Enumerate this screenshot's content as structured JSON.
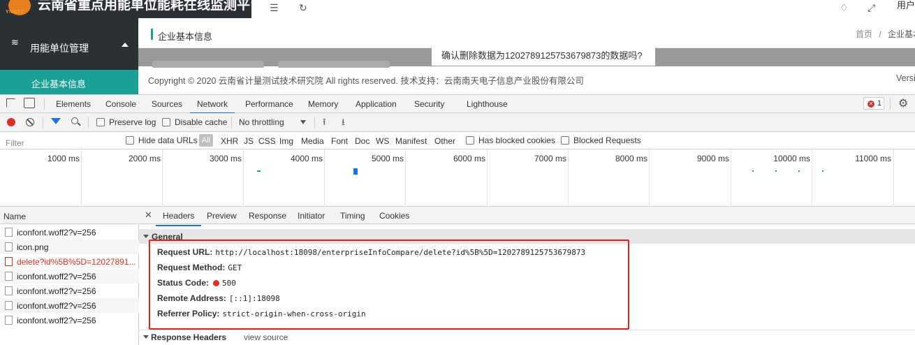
{
  "app": {
    "logo_text": "YNMTT",
    "title": "云南省重点用能单位能耗在线监测平台",
    "user_label": "用户",
    "sidebar": {
      "group_label": "用能单位管理",
      "active_item": "企业基本信息"
    },
    "page_title": "企业基本信息",
    "breadcrumb": [
      "首页",
      "/",
      "企业基本信"
    ],
    "confirm_text": "确认删除数据为1202789125753679873的数据吗?",
    "copyright": "Copyright © 2020 云南省计量测试技术研究院 All rights reserved. 技术支持：云南南天电子信息产业股份有限公司",
    "version": "Versi"
  },
  "devtools": {
    "tabs": [
      "Elements",
      "Console",
      "Sources",
      "Network",
      "Performance",
      "Memory",
      "Application",
      "Security",
      "Lighthouse"
    ],
    "active_tab": "Network",
    "error_count": "1",
    "toolbar": {
      "preserve_log": "Preserve log",
      "disable_cache": "Disable cache",
      "throttling": "No throttling"
    },
    "filter": {
      "placeholder": "Filter",
      "hide_data_urls": "Hide data URLs",
      "all": "All",
      "types": [
        "XHR",
        "JS",
        "CSS",
        "Img",
        "Media",
        "Font",
        "Doc",
        "WS",
        "Manifest",
        "Other"
      ],
      "has_blocked_cookies": "Has blocked cookies",
      "blocked_requests": "Blocked Requests"
    },
    "timeline_labels": [
      "1000 ms",
      "2000 ms",
      "3000 ms",
      "4000 ms",
      "5000 ms",
      "6000 ms",
      "7000 ms",
      "8000 ms",
      "9000 ms",
      "10000 ms",
      "11000 ms"
    ],
    "names_header": "Name",
    "requests": [
      {
        "name": "iconfont.woff2?v=256",
        "error": false
      },
      {
        "name": "icon.png",
        "error": false
      },
      {
        "name": "delete?id%5B%5D=12027891...",
        "error": true
      },
      {
        "name": "iconfont.woff2?v=256",
        "error": false
      },
      {
        "name": "iconfont.woff2?v=256",
        "error": false
      },
      {
        "name": "iconfont.woff2?v=256",
        "error": false
      },
      {
        "name": "iconfont.woff2?v=256",
        "error": false
      }
    ],
    "detail_tabs": [
      "Headers",
      "Preview",
      "Response",
      "Initiator",
      "Timing",
      "Cookies"
    ],
    "active_detail_tab": "Headers",
    "general": {
      "section_label": "General",
      "request_url_key": "Request URL:",
      "request_url": "http://localhost:18098/enterpriseInfoCompare/delete?id%5B%5D=1202789125753679873",
      "request_method_key": "Request Method:",
      "request_method": "GET",
      "status_code_key": "Status Code:",
      "status_code": "500",
      "remote_address_key": "Remote Address:",
      "remote_address": "[::1]:18098",
      "referrer_policy_key": "Referrer Policy:",
      "referrer_policy": "strict-origin-when-cross-origin"
    },
    "response_headers": {
      "label": "Response Headers",
      "view_source": "view source"
    }
  },
  "colors": {
    "sidebar_bg": "#2b3035",
    "accent_teal": "#1aa094",
    "error_red": "#d93025",
    "highlight_box": "#e0201a",
    "devtools_blue": "#1a73e8"
  }
}
